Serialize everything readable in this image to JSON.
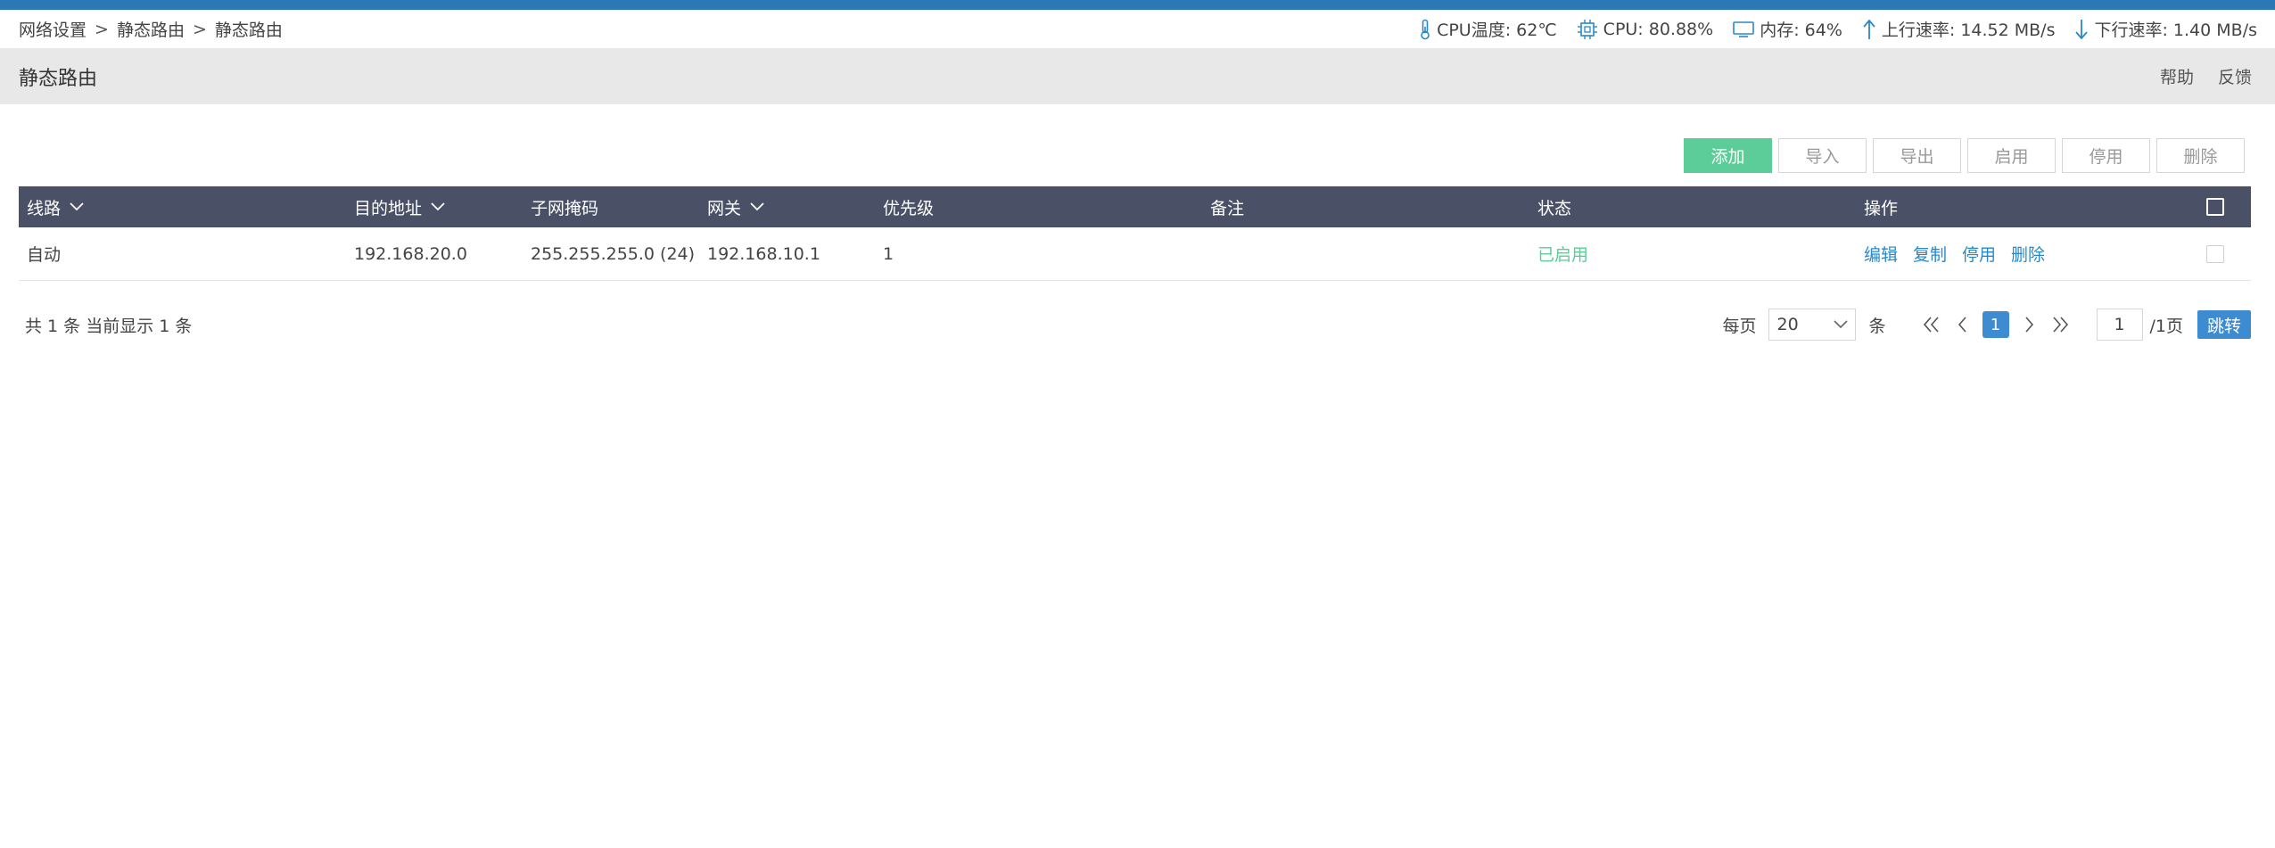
{
  "breadcrumb": {
    "items": [
      "网络设置",
      "静态路由",
      "静态路由"
    ],
    "separator": ">"
  },
  "status": {
    "cpu_temp": "CPU温度: 62℃",
    "cpu": "CPU: 80.88%",
    "memory": "内存: 64%",
    "upload": "上行速率: 14.52 MB/s",
    "download": "下行速率: 1.40 MB/s"
  },
  "page": {
    "title": "静态路由",
    "help": "帮助",
    "feedback": "反馈"
  },
  "toolbar": {
    "add": "添加",
    "import": "导入",
    "export": "导出",
    "enable": "启用",
    "disable": "停用",
    "delete": "删除"
  },
  "table": {
    "headers": {
      "line": "线路",
      "dest": "目的地址",
      "mask": "子网掩码",
      "gateway": "网关",
      "priority": "优先级",
      "remark": "备注",
      "status": "状态",
      "ops": "操作"
    },
    "rows": [
      {
        "line": "自动",
        "dest": "192.168.20.0",
        "mask": "255.255.255.0 (24)",
        "gateway": "192.168.10.1",
        "priority": "1",
        "remark": "",
        "status": "已启用",
        "ops": [
          "编辑",
          "复制",
          "停用",
          "删除"
        ]
      }
    ]
  },
  "footer": {
    "summary": "共 1 条 当前显示 1 条",
    "per_page_label": "每页",
    "per_page_value": "20",
    "unit_label": "条",
    "current_page": "1",
    "page_input": "1",
    "total_pages": "/1页",
    "jump": "跳转"
  },
  "colors": {
    "top_strip": "#2a78b6",
    "header_bg": "#4a5066",
    "primary_green": "#5ccd98",
    "link_blue": "#2a88c8",
    "page_blue": "#3d8bd1"
  },
  "icons": {
    "cpu_temp": "thermometer-icon",
    "cpu": "chip-icon",
    "memory": "monitor-icon",
    "upload": "arrow-up-icon",
    "download": "arrow-down-icon"
  }
}
